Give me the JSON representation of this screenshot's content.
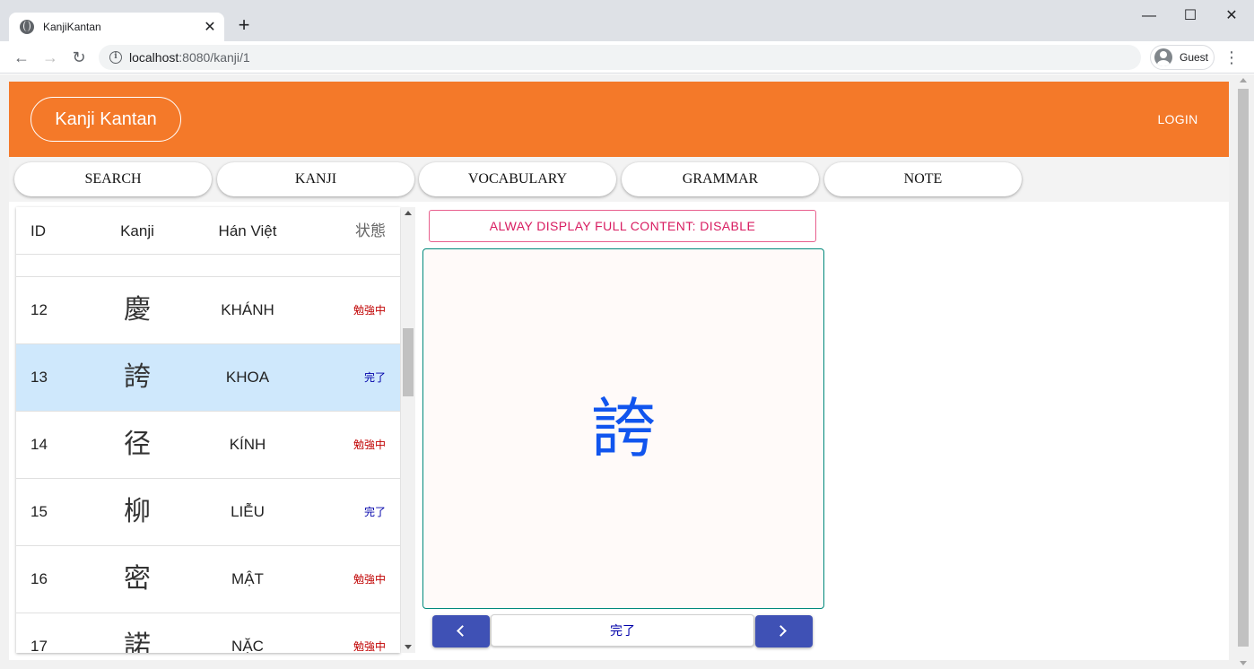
{
  "browser": {
    "tab_title": "KanjiKantan",
    "url_host": "localhost",
    "url_rest": ":8080/kanji/1",
    "profile_name": "Guest"
  },
  "header": {
    "brand": "Kanji Kantan",
    "login": "LOGIN",
    "accent_color": "#f47929"
  },
  "nav": {
    "items": [
      {
        "label": "SEARCH"
      },
      {
        "label": "KANJI"
      },
      {
        "label": "VOCABULARY"
      },
      {
        "label": "GRAMMAR"
      },
      {
        "label": "NOTE"
      }
    ]
  },
  "table": {
    "columns": [
      "ID",
      "Kanji",
      "Hán Việt",
      "状態"
    ],
    "rows": [
      {
        "id": "12",
        "kanji": "慶",
        "han_viet": "KHÁNH",
        "status": "勉強中",
        "status_type": "study"
      },
      {
        "id": "13",
        "kanji": "誇",
        "han_viet": "KHOA",
        "status": "完了",
        "status_type": "done",
        "selected": true
      },
      {
        "id": "14",
        "kanji": "径",
        "han_viet": "KÍNH",
        "status": "勉強中",
        "status_type": "study"
      },
      {
        "id": "15",
        "kanji": "柳",
        "han_viet": "LIỄU",
        "status": "完了",
        "status_type": "done"
      },
      {
        "id": "16",
        "kanji": "密",
        "han_viet": "MẬT",
        "status": "勉強中",
        "status_type": "study"
      },
      {
        "id": "17",
        "kanji": "諾",
        "han_viet": "NẶC",
        "status": "勉強中",
        "status_type": "study"
      }
    ],
    "selected_color": "#cfe8fc"
  },
  "detail": {
    "toggle_label": "ALWAY DISPLAY FULL CONTENT: DISABLE",
    "kanji": "誇",
    "status": "完了"
  }
}
